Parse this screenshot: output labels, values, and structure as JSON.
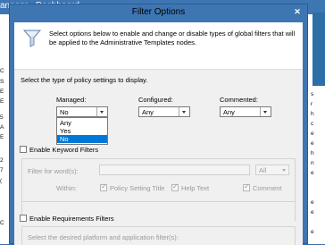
{
  "background": {
    "title": "anager › Dashboard",
    "left_letters": [
      "C",
      "S",
      "E",
      "E",
      "5",
      "A",
      "E",
      "2",
      "7",
      "(",
      "C"
    ],
    "right_letters": [
      "s",
      "r",
      "h",
      "c",
      "e",
      "e",
      "h",
      "n",
      "e",
      "e",
      "e",
      "e"
    ]
  },
  "dialog": {
    "title": "Filter Options",
    "close_glyph": "✕",
    "description": "Select options below to enable and change or disable types of global filters that will be applied to the Administrative Templates nodes.",
    "prompt": "Select the type of policy settings to display.",
    "policy_filters": {
      "managed": {
        "label": "Managed:",
        "value": "No",
        "options": [
          "Any",
          "Yes",
          "No"
        ],
        "selected_option": "No"
      },
      "configured": {
        "label": "Configured:",
        "value": "Any"
      },
      "commented": {
        "label": "Commented:",
        "value": "Any"
      }
    },
    "keyword_filters": {
      "enable_label": "Enable Keyword Filters",
      "filter_for_words_label": "Filter for word(s):",
      "filter_for_words_value": "",
      "match_value": "All",
      "within_label": "Within:",
      "within_options": [
        {
          "label": "Policy Setting Title",
          "checked": true
        },
        {
          "label": "Help Text",
          "checked": true
        },
        {
          "label": "Comment",
          "checked": true
        }
      ]
    },
    "requirements_filters": {
      "enable_label": "Enable Requirements Filters",
      "platform_prompt": "Select the desired platform and application filter(s):"
    }
  },
  "colors": {
    "titlebar": "#3d76b3",
    "selected_option": "#0078d7",
    "client_background": "#f0f0f0"
  }
}
